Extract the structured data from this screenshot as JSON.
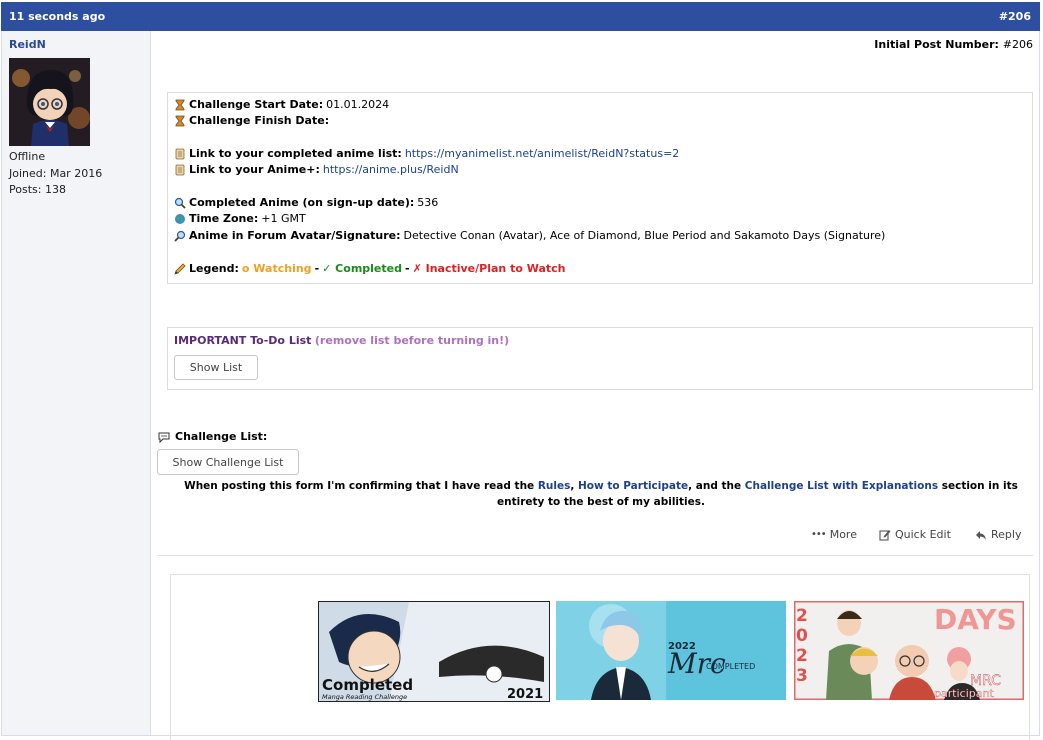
{
  "header": {
    "time": "11 seconds ago",
    "post_number": "#206"
  },
  "user": {
    "name": "ReidN",
    "status": "Offline",
    "joined": "Joined: Mar 2016",
    "posts": "Posts: 138"
  },
  "initial_post": {
    "label": "Initial Post Number:",
    "value": "#206"
  },
  "details": {
    "start_label": "Challenge Start Date:",
    "start_value": "01.01.2024",
    "finish_label": "Challenge Finish Date:",
    "list_label": "Link to your completed anime list:",
    "list_url": "https://myanimelist.net/animelist/ReidN?status=2",
    "animeplus_label": "Link to your Anime+:",
    "animeplus_url": "https://anime.plus/ReidN",
    "completed_label": "Completed Anime (on sign-up date):",
    "completed_value": "536",
    "timezone_label": "Time Zone:",
    "timezone_value": "+1 GMT",
    "avatar_label": "Anime in Forum Avatar/Signature:",
    "avatar_value": "Detective Conan (Avatar), Ace of Diamond, Blue Period and Sakamoto Days (Signature)",
    "legend_label": "Legend:",
    "legend_watching": "o Watching",
    "legend_sep": "-",
    "legend_completed": "✓ Completed",
    "legend_inactive": "✗ Inactive/Plan to Watch"
  },
  "todo": {
    "title": "IMPORTANT To-Do List",
    "note": "(remove list before turning in!)",
    "button": "Show List"
  },
  "challenge": {
    "label": "Challenge List:",
    "button": "Show Challenge List"
  },
  "confirm": {
    "p1": "When posting this form I'm confirming that I have read the ",
    "rules": "Rules",
    "comma": ", ",
    "how": "How to Participate",
    "p2": ", and the ",
    "list": "Challenge List with Explanations",
    "p3": " section in its entirety to the best of my abilities."
  },
  "actions": {
    "more": "More",
    "quick_edit": "Quick Edit",
    "reply": "Reply"
  },
  "signature": {
    "banner1_main": "Completed",
    "banner1_sub": "Manga Reading Challenge",
    "banner1_year": "2021",
    "banner2_year": "2022",
    "banner2_main": "Mrc",
    "banner2_sub": "COMPLETED",
    "banner3_year": "2023",
    "banner3_top": "DAYS",
    "banner3_main": "MRC",
    "banner3_sub": "participant"
  },
  "colors": {
    "header_bg": "#2e4fa0",
    "link": "#1d3f8f",
    "watching": "#f0a020",
    "completed": "#1a8a1a",
    "inactive": "#e02020",
    "todo_title": "#5a2a7a",
    "todo_note": "#b070c0"
  }
}
